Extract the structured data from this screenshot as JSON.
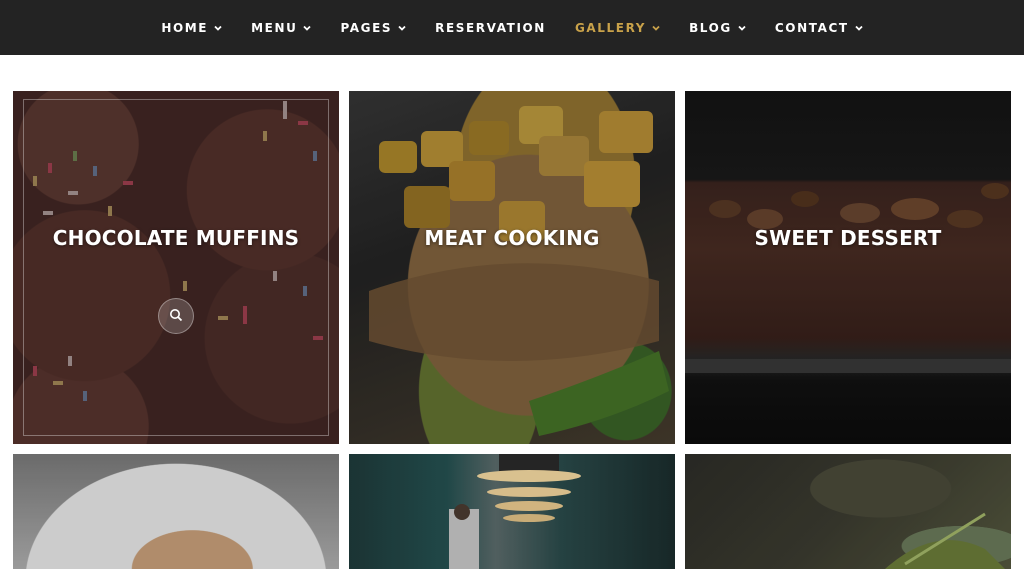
{
  "nav": {
    "items": [
      {
        "label": "HOME",
        "has_dropdown": true,
        "active": false
      },
      {
        "label": "MENU",
        "has_dropdown": true,
        "active": false
      },
      {
        "label": "PAGES",
        "has_dropdown": true,
        "active": false
      },
      {
        "label": "RESERVATION",
        "has_dropdown": false,
        "active": false
      },
      {
        "label": "GALLERY",
        "has_dropdown": true,
        "active": true
      },
      {
        "label": "BLOG",
        "has_dropdown": true,
        "active": false
      },
      {
        "label": "CONTACT",
        "has_dropdown": true,
        "active": false
      }
    ],
    "active_color": "#c9a24a"
  },
  "gallery": {
    "tiles": [
      {
        "title": "CHOCOLATE MUFFINS",
        "image": "chocolate-muffins-photo",
        "hovered": true
      },
      {
        "title": "MEAT COOKING",
        "image": "meat-cooking-photo",
        "hovered": false
      },
      {
        "title": "SWEET DESSERT",
        "image": "sweet-dessert-photo",
        "hovered": false
      },
      {
        "title": "",
        "image": "cake-photo",
        "hovered": false
      },
      {
        "title": "",
        "image": "restaurant-interior-photo",
        "hovered": false
      },
      {
        "title": "",
        "image": "chef-hands-photo",
        "hovered": false
      }
    ]
  },
  "icons": {
    "dropdown": "chevron-down-icon",
    "zoom": "search-icon"
  }
}
